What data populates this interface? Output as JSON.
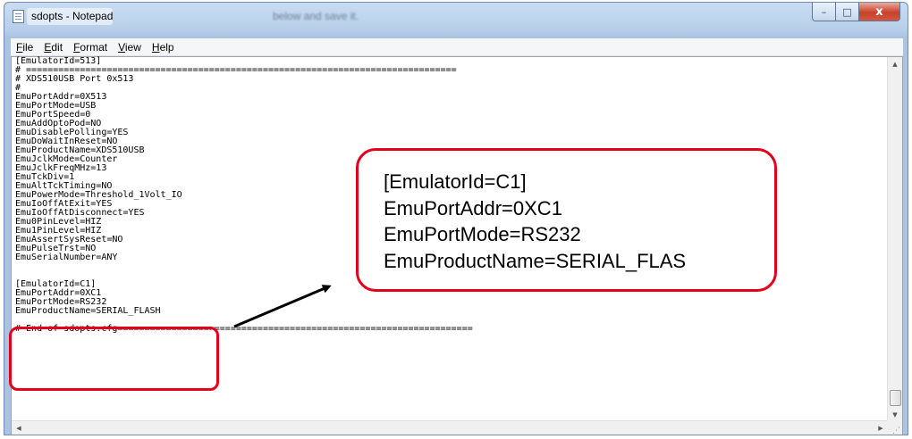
{
  "window": {
    "title": "sdopts - Notepad",
    "background_title": "below and save it.",
    "controls": {
      "minimize": "–",
      "maximize": "□",
      "close": "x"
    }
  },
  "menu": [
    "File",
    "Edit",
    "Format",
    "View",
    "Help"
  ],
  "editor": {
    "lines": [
      "[EmulatorId=513]",
      "# ================================================================================",
      "# XDS510USB Port 0x513",
      "#",
      "EmuPortAddr=0X513",
      "EmuPortMode=USB",
      "EmuPortSpeed=0",
      "EmuAddOptoPod=NO",
      "EmuDisablePolling=YES",
      "EmuDoWaitInReset=NO",
      "EmuProductName=XDS510USB",
      "EmuJclkMode=Counter",
      "EmuJclkFreqMHz=13",
      "EmuTckDiv=1",
      "EmuAltTckTiming=NO",
      "EmuPowerMode=Threshold_1Volt_IO",
      "EmuIoOffAtExit=YES",
      "EmuIoOffAtDisconnect=YES",
      "Emu0PinLevel=HIZ",
      "Emu1PinLevel=HIZ",
      "EmuAssertSysReset=NO",
      "EmuPulseTrst=NO",
      "EmuSerialNumber=ANY",
      "",
      "",
      "[EmulatorId=C1]",
      "EmuPortAddr=0XC1",
      "EmuPortMode=RS232",
      "EmuProductName=SERIAL_FLASH",
      "",
      "# End of sdopts.cfg=================================================================="
    ]
  },
  "callout": {
    "lines": [
      "[EmulatorId=C1]",
      "EmuPortAddr=0XC1",
      "EmuPortMode=RS232",
      "EmuProductName=SERIAL_FLAS"
    ]
  },
  "colors": {
    "highlight_border": "#e3001b",
    "arrow": "#000000"
  },
  "icons": {
    "app": "notepad-icon",
    "vscroll_up": "scroll-up-arrow-icon",
    "vscroll_down": "scroll-down-arrow-icon",
    "hscroll_left": "scroll-left-arrow-icon",
    "hscroll_right": "scroll-right-arrow-icon"
  }
}
